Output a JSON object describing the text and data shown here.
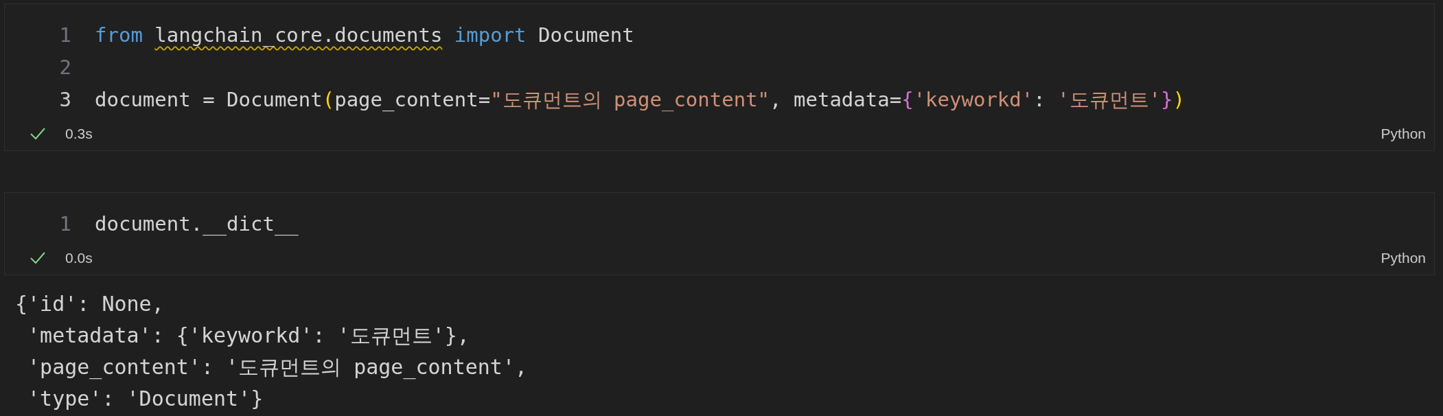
{
  "cells": [
    {
      "lines": [
        {
          "number": "1",
          "current": false,
          "tokens": [
            {
              "text": "from ",
              "kind": "keyword"
            },
            {
              "text": "langchain_core.documents",
              "kind": "plain",
              "warning": true
            },
            {
              "text": " import",
              "kind": "keyword"
            },
            {
              "text": " Document",
              "kind": "plain"
            }
          ]
        },
        {
          "number": "2",
          "current": false
        },
        {
          "number": "3",
          "current": true,
          "tokens": [
            {
              "text": "document = Document",
              "kind": "plain"
            },
            {
              "text": "(",
              "kind": "bracket1"
            },
            {
              "text": "page_content=",
              "kind": "plain"
            },
            {
              "text": "\"도큐먼트의 page_content\"",
              "kind": "string"
            },
            {
              "text": ", metadata=",
              "kind": "plain"
            },
            {
              "text": "{",
              "kind": "bracket2"
            },
            {
              "text": "'keyworkd'",
              "kind": "string"
            },
            {
              "text": ": ",
              "kind": "plain"
            },
            {
              "text": "'도큐먼트'",
              "kind": "string"
            },
            {
              "text": "}",
              "kind": "bracket2"
            },
            {
              "text": ")",
              "kind": "bracket1"
            }
          ]
        }
      ],
      "status": {
        "success": true,
        "time": "0.3s"
      },
      "language": "Python"
    },
    {
      "lines": [
        {
          "number": "1",
          "current": false,
          "tokens": [
            {
              "text": "document.__dict__",
              "kind": "plain"
            }
          ]
        }
      ],
      "status": {
        "success": true,
        "time": "0.0s"
      },
      "language": "Python",
      "output": [
        "{'id': None,",
        " 'metadata': {'keyworkd': '도큐먼트'},",
        " 'page_content': '도큐먼트의 page_content',",
        " 'type': 'Document'}"
      ]
    }
  ]
}
